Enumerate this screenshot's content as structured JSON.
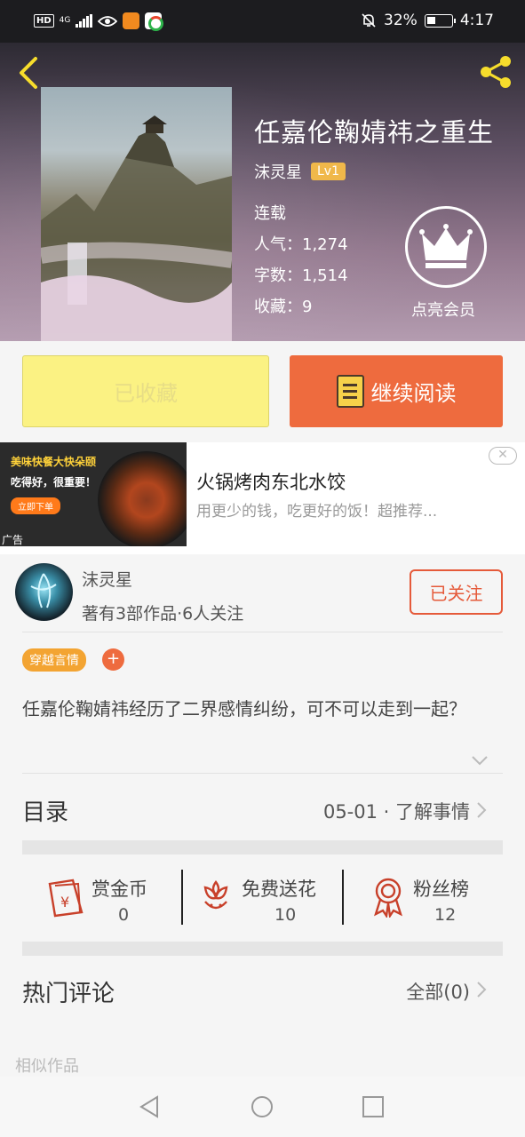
{
  "status_bar": {
    "hd": "HD",
    "network": "4G",
    "battery_percent": "32%",
    "time": "4:17"
  },
  "book": {
    "title": "任嘉伦鞠婧祎之重生",
    "author": "沫灵星",
    "level": "Lv1",
    "status": "连载",
    "popularity_label": "人气：",
    "popularity": "1,274",
    "word_count_label": "字数：",
    "word_count": "1,514",
    "favorites_label": "收藏：",
    "favorites": "9",
    "vip_label": "点亮会员"
  },
  "actions": {
    "favorited_label": "已收藏",
    "continue_label": "继续阅读"
  },
  "ad": {
    "image_line1": "美味快餐大快朵颐",
    "image_line2": "吃得好，很重要！",
    "image_button": "立即下单",
    "label": "广告",
    "title": "火锅烤肉东北水饺",
    "description": "用更少的钱，吃更好的饭！超推荐..."
  },
  "author_card": {
    "name": "沫灵星",
    "meta": "著有3部作品·6人关注",
    "follow_label": "已关注"
  },
  "tags": [
    "穿越言情"
  ],
  "tag_add": "+",
  "intro": "任嘉伦鞠婧祎经历了二界感情纠纷，可不可以走到一起？",
  "toc": {
    "label": "目录",
    "latest": "05-01 · 了解事情"
  },
  "stats": [
    {
      "label": "赏金币",
      "value": "0",
      "icon": "reward-coin-icon"
    },
    {
      "label": "免费送花",
      "value": "10",
      "icon": "flower-icon"
    },
    {
      "label": "粉丝榜",
      "value": "12",
      "icon": "medal-icon"
    }
  ],
  "comments": {
    "label": "热门评论",
    "all_label": "全部(0)"
  },
  "similar_label": "相似作品",
  "colors": {
    "accent": "#ee6b3e",
    "favorited_bg": "#fbf283",
    "level_badge": "#f0b84a",
    "tag": "#f3a432",
    "icon_red": "#c8402a"
  }
}
